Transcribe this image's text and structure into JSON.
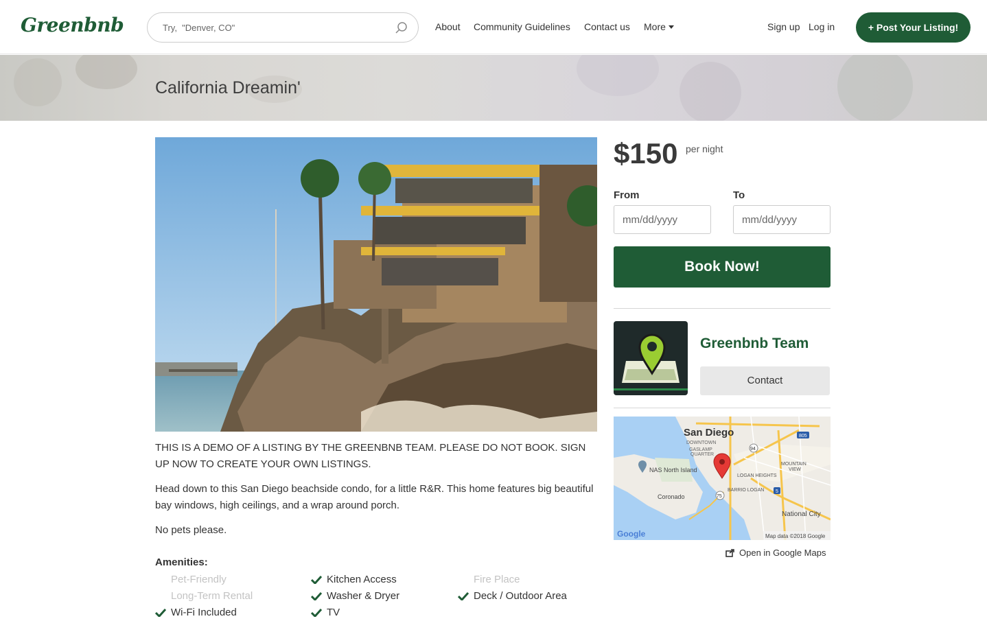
{
  "nav": {
    "logo": "Greenbnb",
    "search_placeholder": "Try,  \"Denver, CO\"",
    "links": [
      "About",
      "Community Guidelines",
      "Contact us",
      "More"
    ],
    "signup": "Sign up",
    "login": "Log in",
    "post_listing": "+ Post Your Listing!"
  },
  "hero": {
    "title": "California Dreamin'"
  },
  "listing": {
    "disclaimer": "THIS IS A DEMO OF A LISTING BY THE GREENBNB TEAM. PLEASE DO NOT BOOK. SIGN UP NOW TO CREATE YOUR OWN LISTINGS.",
    "description": "Head down to this San Diego beachside condo, for a little R&R. This home features big beautiful bay windows, high ceilings, and a wrap around porch.",
    "note": "No pets please.",
    "amenities_title": "Amenities:",
    "amenities": [
      {
        "label": "Pet-Friendly",
        "available": false
      },
      {
        "label": "Kitchen Access",
        "available": true
      },
      {
        "label": "Fire Place",
        "available": false
      },
      {
        "label": "Long-Term Rental",
        "available": false
      },
      {
        "label": "Washer & Dryer",
        "available": true
      },
      {
        "label": "Deck / Outdoor Area",
        "available": true
      },
      {
        "label": "Wi-Fi Included",
        "available": true
      },
      {
        "label": "TV",
        "available": true
      }
    ]
  },
  "booking": {
    "price": "$150",
    "per_night": "per night",
    "from_label": "From",
    "to_label": "To",
    "from_placeholder": "mm/dd/yyyy",
    "to_placeholder": "mm/dd/yyyy",
    "book_button": "Book Now!"
  },
  "host": {
    "name": "Greenbnb Team",
    "contact_button": "Contact"
  },
  "map": {
    "labels": {
      "city": "San Diego",
      "downtown": "DOWNTOWN",
      "gaslamp": "GASLAMP",
      "quarter": "QUARTER",
      "nas": "NAS North Island",
      "coronado": "Coronado",
      "logan_heights": "LOGAN HEIGHTS",
      "barrio_logan": "BARRIO LOGAN",
      "mountain": "MOUNTAIN",
      "view": "VIEW",
      "national_city": "National City",
      "google": "Google",
      "attribution": "Map data ©2018 Google",
      "route_805": "805",
      "route_94": "94",
      "route_75": "75",
      "route_5": "5"
    },
    "open_link": "Open in Google Maps"
  },
  "colors": {
    "brand_green": "#1f5c36",
    "pin_red": "#e53935",
    "water": "#a9d0f4"
  }
}
